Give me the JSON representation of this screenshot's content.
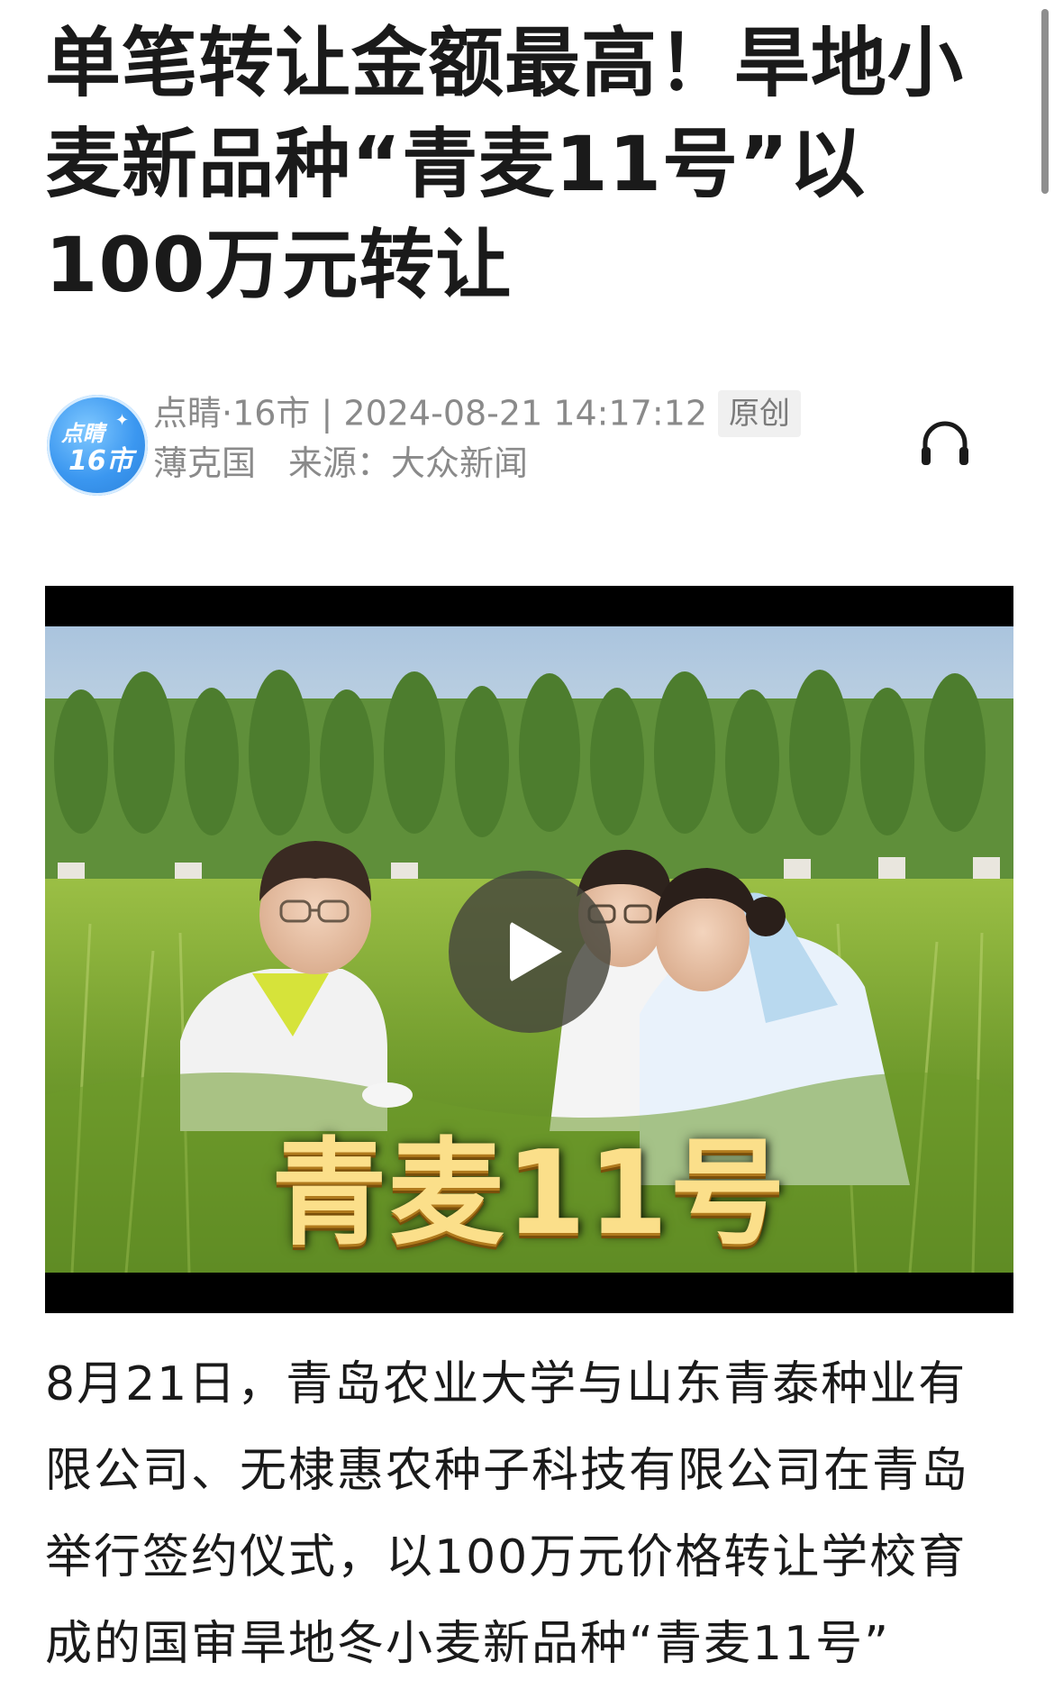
{
  "article": {
    "title": "单笔转让金额最高！旱地小麦新品种“青麦11号”以100万元转让",
    "author_name": "点睛·16市",
    "timestamp": "2024-08-21 14:17:12",
    "original_badge": "原创",
    "editor": "薄克国",
    "source": "来源：大众新闻",
    "avatar_text_line1": "点睛",
    "avatar_text_line2": "16市",
    "body_paragraph": "8月21日，青岛农业大学与山东青泰种业有限公司、无棣惠农种子科技有限公司在青岛举行签约仪式，以100万元价格转让学校育成的国审旱地冬小麦新品种“青麦11号”"
  },
  "video": {
    "caption": "青麦11号"
  },
  "icons": {
    "listen": "headphone-icon",
    "play": "play-icon"
  },
  "colors": {
    "text": "#1a1a1a",
    "meta": "#8a8a8a",
    "badge_bg": "#f0f0f0",
    "caption": "#fbdf8a",
    "avatar": "#3b97f0"
  }
}
